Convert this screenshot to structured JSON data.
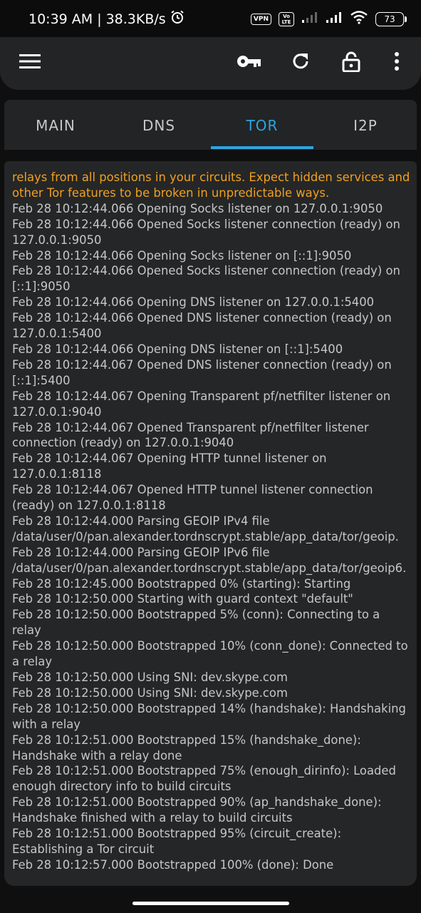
{
  "status_bar": {
    "time": "10:39 AM",
    "separator": "|",
    "net_speed": "38.3KB/s",
    "vpn_badge": "VPN",
    "volte_badge": "Vo LTE",
    "battery": "73"
  },
  "toolbar": {
    "icons": [
      "menu-icon",
      "key-icon",
      "refresh-icon",
      "lock-icon",
      "more-vert-icon"
    ]
  },
  "tabs": [
    {
      "label": "MAIN",
      "active": false
    },
    {
      "label": "DNS",
      "active": false
    },
    {
      "label": "TOR",
      "active": true
    },
    {
      "label": "I2P",
      "active": false
    }
  ],
  "colors": {
    "accent": "#2aa6e0",
    "warning_text": "#f0a020",
    "log_text": "#c6c6c6",
    "panel": "#252627",
    "toolbar": "#232426"
  },
  "log": {
    "warning": "relays from all positions in your circuits. Expect hidden services and other Tor features to be broken in unpredictable ways.",
    "lines": [
      "Feb 28 10:12:44.066 Opening Socks listener on 127.0.0.1:9050",
      "Feb 28 10:12:44.066 Opened Socks listener connection (ready) on 127.0.0.1:9050",
      "Feb 28 10:12:44.066 Opening Socks listener on [::1]:9050",
      "Feb 28 10:12:44.066 Opened Socks listener connection (ready) on [::1]:9050",
      "Feb 28 10:12:44.066 Opening DNS listener on 127.0.0.1:5400",
      "Feb 28 10:12:44.066 Opened DNS listener connection (ready) on 127.0.0.1:5400",
      "Feb 28 10:12:44.066 Opening DNS listener on [::1]:5400",
      "Feb 28 10:12:44.067 Opened DNS listener connection (ready) on [::1]:5400",
      "Feb 28 10:12:44.067 Opening Transparent pf/netfilter listener on 127.0.0.1:9040",
      "Feb 28 10:12:44.067 Opened Transparent pf/netfilter listener connection (ready) on 127.0.0.1:9040",
      "Feb 28 10:12:44.067 Opening HTTP tunnel listener on 127.0.0.1:8118",
      "Feb 28 10:12:44.067 Opened HTTP tunnel listener connection (ready) on 127.0.0.1:8118",
      "Feb 28 10:12:44.000 Parsing GEOIP IPv4 file /data/user/0/pan.alexander.tordnscrypt.stable/app_data/tor/geoip.",
      "Feb 28 10:12:44.000 Parsing GEOIP IPv6 file /data/user/0/pan.alexander.tordnscrypt.stable/app_data/tor/geoip6.",
      "Feb 28 10:12:45.000 Bootstrapped 0% (starting): Starting",
      "Feb 28 10:12:50.000 Starting with guard context \"default\"",
      "Feb 28 10:12:50.000 Bootstrapped 5% (conn): Connecting to a relay",
      "Feb 28 10:12:50.000 Bootstrapped 10% (conn_done): Connected to a relay",
      "Feb 28 10:12:50.000 Using SNI: dev.skype.com",
      "Feb 28 10:12:50.000 Using SNI: dev.skype.com",
      "Feb 28 10:12:50.000 Bootstrapped 14% (handshake): Handshaking with a relay",
      "Feb 28 10:12:51.000 Bootstrapped 15% (handshake_done): Handshake with a relay done",
      "Feb 28 10:12:51.000 Bootstrapped 75% (enough_dirinfo): Loaded enough directory info to build circuits",
      "Feb 28 10:12:51.000 Bootstrapped 90% (ap_handshake_done): Handshake finished with a relay to build circuits",
      "Feb 28 10:12:51.000 Bootstrapped 95% (circuit_create): Establishing a Tor circuit",
      "Feb 28 10:12:57.000 Bootstrapped 100% (done): Done"
    ]
  }
}
